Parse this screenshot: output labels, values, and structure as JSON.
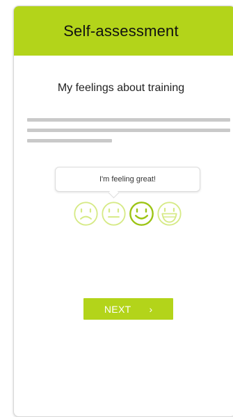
{
  "header": {
    "title": "Self-assessment"
  },
  "section": {
    "title": "My feelings about training"
  },
  "tooltip": {
    "text": "I'm feeling great!"
  },
  "faces": [
    {
      "name": "sad-face-icon",
      "state": "unselected"
    },
    {
      "name": "neutral-face-icon",
      "state": "unselected"
    },
    {
      "name": "happy-face-icon",
      "state": "selected"
    },
    {
      "name": "very-happy-face-icon",
      "state": "unselected"
    }
  ],
  "next_button": {
    "label": "NEXT",
    "icon": "chevron-right-icon",
    "glyph": "›"
  },
  "colors": {
    "accent": "#b3d41a",
    "face_active": "#9cc414",
    "face_inactive": "#d6ea86",
    "placeholder": "#c9c9c9"
  }
}
